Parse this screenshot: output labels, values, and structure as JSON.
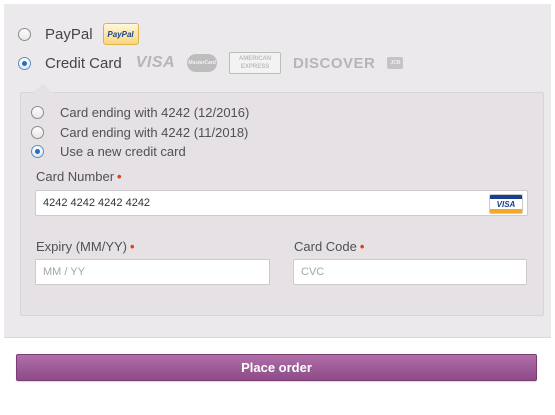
{
  "payment_methods": {
    "paypal": {
      "label": "PayPal",
      "badge_text": "PayPal",
      "selected": false
    },
    "credit_card": {
      "label": "Credit Card",
      "selected": true,
      "logos": {
        "visa": "VISA",
        "mastercard": "MasterCard",
        "amex_line1": "AMERICAN",
        "amex_line2": "EXPRESS",
        "discover": "DISCOVER",
        "jcb": "JCB"
      }
    }
  },
  "saved_cards": [
    {
      "label": "Card ending with 4242 (12/2016)",
      "selected": false
    },
    {
      "label": "Card ending with 4242 (11/2018)",
      "selected": false
    },
    {
      "label": "Use a new credit card",
      "selected": true
    }
  ],
  "form": {
    "card_number": {
      "label": "Card Number",
      "required_mark": "•",
      "value": "4242 4242 4242 4242",
      "card_type_badge": "VISA"
    },
    "expiry": {
      "label": "Expiry (MM/YY)",
      "required_mark": "•",
      "placeholder": "MM / YY"
    },
    "card_code": {
      "label": "Card Code",
      "required_mark": "•",
      "placeholder": "CVC"
    }
  },
  "actions": {
    "place_order_label": "Place order"
  },
  "colors": {
    "accent_button": "#9d5d97",
    "required": "#e2401c",
    "radio_checked": "#2e6db4"
  }
}
